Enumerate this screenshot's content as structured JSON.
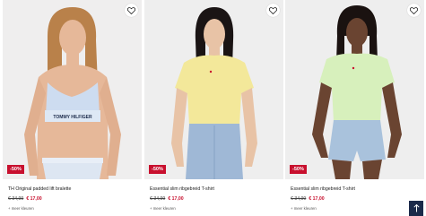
{
  "products": [
    {
      "name": "TH Original padded lift bralette",
      "old_price": "€ 34,99",
      "new_price": "€ 17,00",
      "discount": "-50%",
      "more_colors": "+ meer kleuren",
      "colors": {
        "bg": "#efeeee",
        "top": "#cddcf0",
        "skin": "#e6b899",
        "hair": "#b9814a"
      },
      "image_text": {
        "band": "TOMMY HILFIGER"
      }
    },
    {
      "name": "Essential slim ribgebreid T-shirt",
      "old_price": "€ 34,99",
      "new_price": "€ 17,00",
      "discount": "-50%",
      "more_colors": "+ meer kleuren",
      "colors": {
        "bg": "#eeeeee",
        "top": "#f3e89a",
        "skin": "#e8c3a6",
        "hair": "#1a1414",
        "jeans": "#9fb8d6"
      }
    },
    {
      "name": "Essential slim ribgebreid T-shirt",
      "old_price": "€ 34,99",
      "new_price": "€ 17,00",
      "discount": "-50%",
      "more_colors": "+ meer kleuren",
      "colors": {
        "bg": "#eeeeee",
        "top": "#d7f0bc",
        "skin": "#6a4431",
        "hair": "#1a1210",
        "jeans": "#a9c2dc"
      }
    }
  ],
  "icons": {
    "wishlist": "heart-icon",
    "scroll": "arrow-up-icon"
  }
}
